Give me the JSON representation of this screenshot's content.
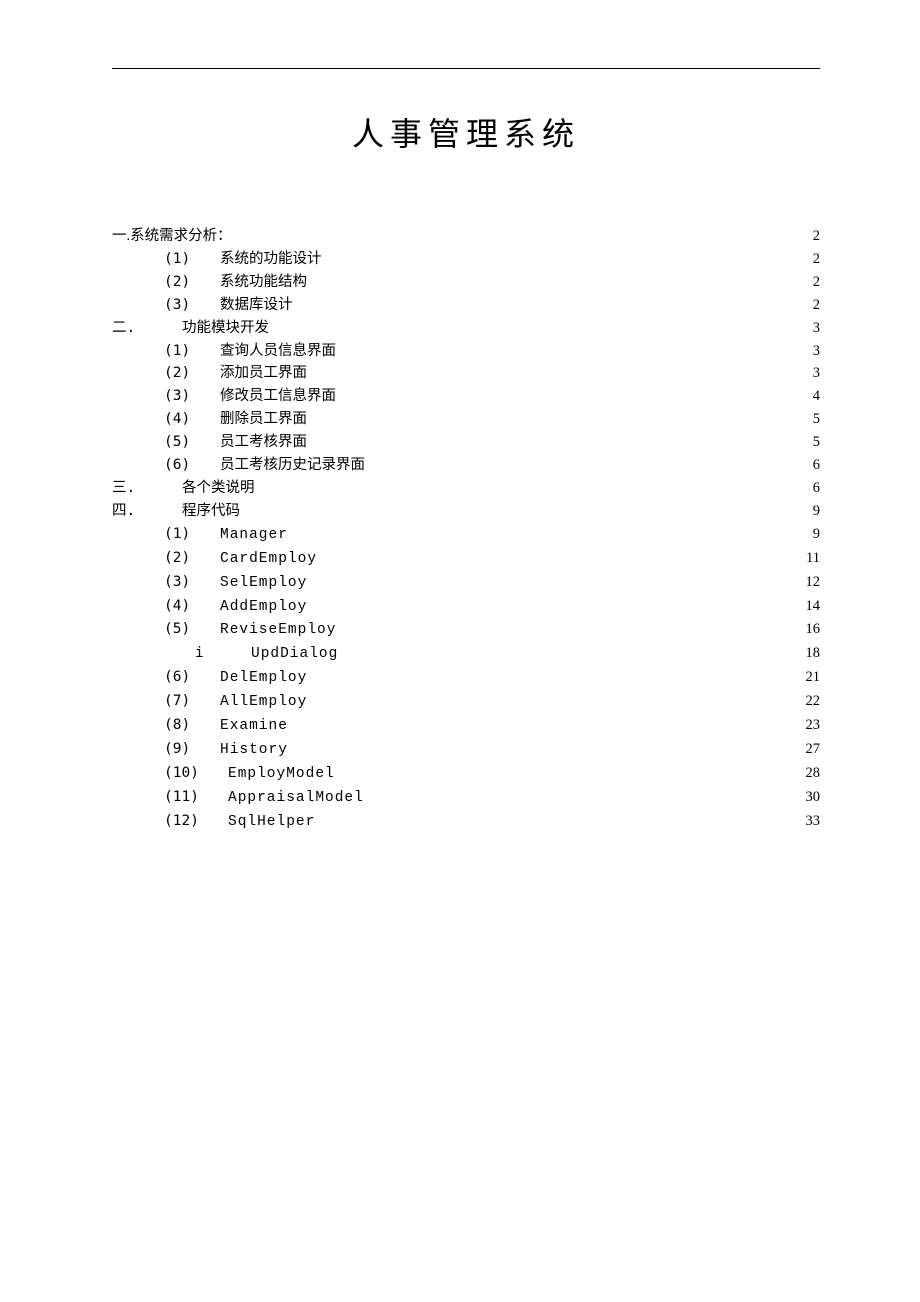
{
  "title": "人事管理系统",
  "toc": [
    {
      "level": 0,
      "num": "",
      "prefix": "一.系统需求分析：",
      "label": "",
      "page": "2"
    },
    {
      "level": 1,
      "num": "(1)",
      "label": "系统的功能设计",
      "page": "2"
    },
    {
      "level": 1,
      "num": "(2)",
      "label": "系统功能结构",
      "page": "2"
    },
    {
      "level": 1,
      "num": "(3)",
      "label": "数据库设计",
      "page": "2"
    },
    {
      "level": 0,
      "num": "二.",
      "label": "功能模块开发",
      "page": "3",
      "offset": true
    },
    {
      "level": 1,
      "num": "(1)",
      "label": "查询人员信息界面",
      "page": "3"
    },
    {
      "level": 1,
      "num": "(2)",
      "label": "添加员工界面",
      "page": "3"
    },
    {
      "level": 1,
      "num": "(3)",
      "label": "修改员工信息界面",
      "page": "4"
    },
    {
      "level": 1,
      "num": "(4)",
      "label": "删除员工界面",
      "page": "5"
    },
    {
      "level": 1,
      "num": "(5)",
      "label": "员工考核界面",
      "page": "5"
    },
    {
      "level": 1,
      "num": "(6)",
      "label": "员工考核历史记录界面",
      "page": "6"
    },
    {
      "level": 0,
      "num": "三.",
      "label": "各个类说明",
      "page": "6",
      "offset": true
    },
    {
      "level": 0,
      "num": "四.",
      "label": "程序代码",
      "page": "9",
      "offset": true
    },
    {
      "level": 1,
      "num": "(1)",
      "label": "Manager",
      "page": "9",
      "mono": true
    },
    {
      "level": 1,
      "num": "(2)",
      "label": "CardEmploy",
      "page": "11",
      "mono": true
    },
    {
      "level": 1,
      "num": "(3)",
      "label": "SelEmploy",
      "page": "12",
      "mono": true
    },
    {
      "level": 1,
      "num": "(4)",
      "label": "AddEmploy",
      "page": "14",
      "mono": true
    },
    {
      "level": 1,
      "num": "(5)",
      "label": "ReviseEmploy",
      "page": "16",
      "mono": true
    },
    {
      "level": 2,
      "num": "i",
      "label": "UpdDialog",
      "page": "18",
      "mono": true
    },
    {
      "level": 1,
      "num": "(6)",
      "label": "DelEmploy",
      "page": "21",
      "mono": true
    },
    {
      "level": 1,
      "num": "(7)",
      "label": "AllEmploy",
      "page": "22",
      "mono": true
    },
    {
      "level": 1,
      "num": "(8)",
      "label": "Examine",
      "page": "23",
      "mono": true
    },
    {
      "level": 1,
      "num": "(9)",
      "label": "History",
      "page": "27",
      "mono": true
    },
    {
      "level": 1,
      "num": "(10)",
      "label": "EmployModel",
      "page": "28",
      "mono": true,
      "wide": true
    },
    {
      "level": 1,
      "num": "(11)",
      "label": "AppraisalModel",
      "page": "30",
      "mono": true,
      "wide": true
    },
    {
      "level": 1,
      "num": "(12)",
      "label": "SqlHelper",
      "page": "33",
      "mono": true,
      "wide": true
    }
  ]
}
